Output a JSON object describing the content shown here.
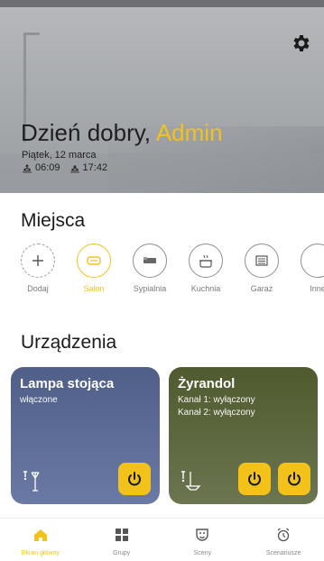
{
  "header": {
    "greeting": "Dzień dobry,",
    "user_name": "Admin",
    "date": "Piątek, 12 marca",
    "sunrise": "06:09",
    "sunset": "17:42",
    "settings_icon": "gear-icon"
  },
  "places": {
    "title": "Miejsca",
    "items": [
      {
        "label": "Dodaj",
        "icon": "plus-icon"
      },
      {
        "label": "Salon",
        "icon": "sofa-icon",
        "selected": true
      },
      {
        "label": "Sypialnia",
        "icon": "bed-icon"
      },
      {
        "label": "Kuchnia",
        "icon": "pot-icon"
      },
      {
        "label": "Garaż",
        "icon": "garage-icon"
      },
      {
        "label": "Inne",
        "icon": "other-icon"
      }
    ]
  },
  "devices": {
    "title": "Urządzenia",
    "items": [
      {
        "name": "Lampa stojąca",
        "status": "włączone",
        "icon": "floor-lamp-icon",
        "buttons": 1
      },
      {
        "name": "Żyrandol",
        "status_lines": [
          "Kanał 1: wyłączony",
          "Kanał 2: wyłączony"
        ],
        "icon": "chandelier-icon",
        "buttons": 2
      }
    ]
  },
  "nav": {
    "items": [
      {
        "label": "Ekran główny",
        "icon": "home-icon",
        "active": true
      },
      {
        "label": "Grupy",
        "icon": "grid-icon"
      },
      {
        "label": "Sceny",
        "icon": "theater-mask-icon"
      },
      {
        "label": "Scenariusze",
        "icon": "alarm-clock-icon"
      }
    ]
  },
  "colors": {
    "accent": "#f2c21b",
    "lamp_card": "#5a6a94",
    "chandelier_card": "#5b6540"
  }
}
